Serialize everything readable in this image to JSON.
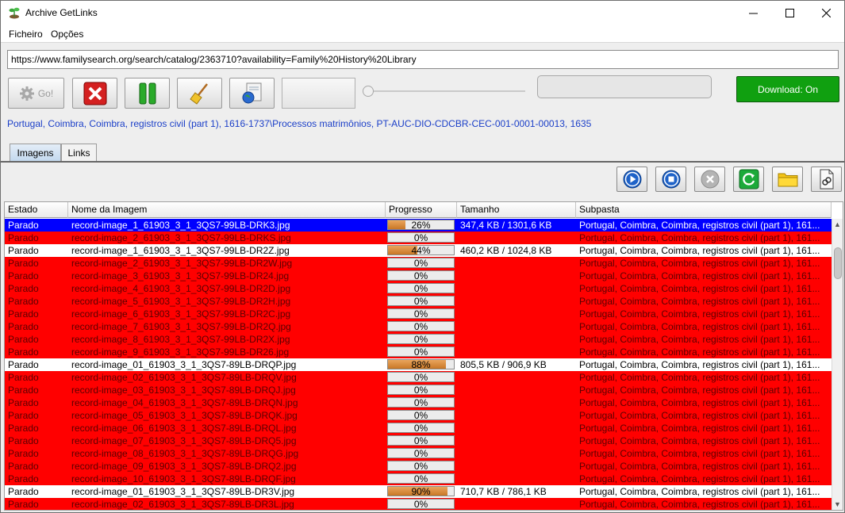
{
  "window": {
    "title": "Archive GetLinks"
  },
  "menu": {
    "items": [
      "Ficheiro",
      "Opções"
    ]
  },
  "url_field": {
    "value": "https://www.familysearch.org/search/catalog/2363710?availability=Family%20History%20Library"
  },
  "toolbar": {
    "go_label": "Go!",
    "download_label": "Download: On"
  },
  "path_label": "Portugal, Coimbra, Coimbra, registros civil (part 1), 1616-1737\\Processos matrimônios, PT-AUC-DIO-CDCBR-CEC-001-0001-00013, 1635",
  "tabs": [
    {
      "label": "Imagens",
      "active": true
    },
    {
      "label": "Links",
      "active": false
    }
  ],
  "table": {
    "columns": [
      "Estado",
      "Nome da Imagem",
      "Progresso",
      "Tamanho",
      "Subpasta"
    ],
    "rows": [
      {
        "style": "sel",
        "estado": "Parado",
        "nome": "record-image_1_61903_3_1_3QS7-99LB-DRK3.jpg",
        "progress": 26,
        "progress_label": "26%",
        "tamanho": "347,4  KB / 1301,6  KB",
        "subpasta": "Portugal, Coimbra, Coimbra, registros civil (part 1), 161..."
      },
      {
        "style": "red",
        "estado": "Parado",
        "nome": "record-image_2_61903_3_1_3QS7-99LB-DRKS.jpg",
        "progress": 0,
        "progress_label": "0%",
        "tamanho": "",
        "subpasta": "Portugal, Coimbra, Coimbra, registros civil (part 1), 161..."
      },
      {
        "style": "white",
        "estado": "Parado",
        "nome": "record-image_1_61903_3_1_3QS7-99LB-DR2Z.jpg",
        "progress": 44,
        "progress_label": "44%",
        "tamanho": "460,2  KB / 1024,8  KB",
        "subpasta": "Portugal, Coimbra, Coimbra, registros civil (part 1), 161..."
      },
      {
        "style": "red",
        "estado": "Parado",
        "nome": "record-image_2_61903_3_1_3QS7-99LB-DR2W.jpg",
        "progress": 0,
        "progress_label": "0%",
        "tamanho": "",
        "subpasta": "Portugal, Coimbra, Coimbra, registros civil (part 1), 161..."
      },
      {
        "style": "red",
        "estado": "Parado",
        "nome": "record-image_3_61903_3_1_3QS7-99LB-DR24.jpg",
        "progress": 0,
        "progress_label": "0%",
        "tamanho": "",
        "subpasta": "Portugal, Coimbra, Coimbra, registros civil (part 1), 161..."
      },
      {
        "style": "red",
        "estado": "Parado",
        "nome": "record-image_4_61903_3_1_3QS7-99LB-DR2D.jpg",
        "progress": 0,
        "progress_label": "0%",
        "tamanho": "",
        "subpasta": "Portugal, Coimbra, Coimbra, registros civil (part 1), 161..."
      },
      {
        "style": "red",
        "estado": "Parado",
        "nome": "record-image_5_61903_3_1_3QS7-99LB-DR2H.jpg",
        "progress": 0,
        "progress_label": "0%",
        "tamanho": "",
        "subpasta": "Portugal, Coimbra, Coimbra, registros civil (part 1), 161..."
      },
      {
        "style": "red",
        "estado": "Parado",
        "nome": "record-image_6_61903_3_1_3QS7-99LB-DR2C.jpg",
        "progress": 0,
        "progress_label": "0%",
        "tamanho": "",
        "subpasta": "Portugal, Coimbra, Coimbra, registros civil (part 1), 161..."
      },
      {
        "style": "red",
        "estado": "Parado",
        "nome": "record-image_7_61903_3_1_3QS7-99LB-DR2Q.jpg",
        "progress": 0,
        "progress_label": "0%",
        "tamanho": "",
        "subpasta": "Portugal, Coimbra, Coimbra, registros civil (part 1), 161..."
      },
      {
        "style": "red",
        "estado": "Parado",
        "nome": "record-image_8_61903_3_1_3QS7-99LB-DR2X.jpg",
        "progress": 0,
        "progress_label": "0%",
        "tamanho": "",
        "subpasta": "Portugal, Coimbra, Coimbra, registros civil (part 1), 161..."
      },
      {
        "style": "red",
        "estado": "Parado",
        "nome": "record-image_9_61903_3_1_3QS7-99LB-DR26.jpg",
        "progress": 0,
        "progress_label": "0%",
        "tamanho": "",
        "subpasta": "Portugal, Coimbra, Coimbra, registros civil (part 1), 161..."
      },
      {
        "style": "white",
        "estado": "Parado",
        "nome": "record-image_01_61903_3_1_3QS7-89LB-DRQP.jpg",
        "progress": 88,
        "progress_label": "88%",
        "tamanho": "805,5  KB / 906,9  KB",
        "subpasta": "Portugal, Coimbra, Coimbra, registros civil (part 1), 161..."
      },
      {
        "style": "red",
        "estado": "Parado",
        "nome": "record-image_02_61903_3_1_3QS7-89LB-DRQV.jpg",
        "progress": 0,
        "progress_label": "0%",
        "tamanho": "",
        "subpasta": "Portugal, Coimbra, Coimbra, registros civil (part 1), 161..."
      },
      {
        "style": "red",
        "estado": "Parado",
        "nome": "record-image_03_61903_3_1_3QS7-89LB-DRQJ.jpg",
        "progress": 0,
        "progress_label": "0%",
        "tamanho": "",
        "subpasta": "Portugal, Coimbra, Coimbra, registros civil (part 1), 161..."
      },
      {
        "style": "red",
        "estado": "Parado",
        "nome": "record-image_04_61903_3_1_3QS7-89LB-DRQN.jpg",
        "progress": 0,
        "progress_label": "0%",
        "tamanho": "",
        "subpasta": "Portugal, Coimbra, Coimbra, registros civil (part 1), 161..."
      },
      {
        "style": "red",
        "estado": "Parado",
        "nome": "record-image_05_61903_3_1_3QS7-89LB-DRQK.jpg",
        "progress": 0,
        "progress_label": "0%",
        "tamanho": "",
        "subpasta": "Portugal, Coimbra, Coimbra, registros civil (part 1), 161..."
      },
      {
        "style": "red",
        "estado": "Parado",
        "nome": "record-image_06_61903_3_1_3QS7-89LB-DRQL.jpg",
        "progress": 0,
        "progress_label": "0%",
        "tamanho": "",
        "subpasta": "Portugal, Coimbra, Coimbra, registros civil (part 1), 161..."
      },
      {
        "style": "red",
        "estado": "Parado",
        "nome": "record-image_07_61903_3_1_3QS7-89LB-DRQ5.jpg",
        "progress": 0,
        "progress_label": "0%",
        "tamanho": "",
        "subpasta": "Portugal, Coimbra, Coimbra, registros civil (part 1), 161..."
      },
      {
        "style": "red",
        "estado": "Parado",
        "nome": "record-image_08_61903_3_1_3QS7-89LB-DRQG.jpg",
        "progress": 0,
        "progress_label": "0%",
        "tamanho": "",
        "subpasta": "Portugal, Coimbra, Coimbra, registros civil (part 1), 161..."
      },
      {
        "style": "red",
        "estado": "Parado",
        "nome": "record-image_09_61903_3_1_3QS7-89LB-DRQ2.jpg",
        "progress": 0,
        "progress_label": "0%",
        "tamanho": "",
        "subpasta": "Portugal, Coimbra, Coimbra, registros civil (part 1), 161..."
      },
      {
        "style": "red",
        "estado": "Parado",
        "nome": "record-image_10_61903_3_1_3QS7-89LB-DRQF.jpg",
        "progress": 0,
        "progress_label": "0%",
        "tamanho": "",
        "subpasta": "Portugal, Coimbra, Coimbra, registros civil (part 1), 161..."
      },
      {
        "style": "white",
        "estado": "Parado",
        "nome": "record-image_01_61903_3_1_3QS7-89LB-DR3V.jpg",
        "progress": 90,
        "progress_label": "90%",
        "tamanho": "710,7  KB / 786,1  KB",
        "subpasta": "Portugal, Coimbra, Coimbra, registros civil (part 1), 161..."
      },
      {
        "style": "red",
        "estado": "Parado",
        "nome": "record-image_02_61903_3_1_3QS7-89LB-DR3L.jpg",
        "progress": 0,
        "progress_label": "0%",
        "tamanho": "",
        "subpasta": "Portugal, Coimbra, Coimbra, registros civil (part 1), 161..."
      }
    ]
  },
  "colors": {
    "row_red": "#ff0000",
    "row_selected": "#0000ff",
    "download_green": "#10a010",
    "path_blue": "#1b3fc8",
    "progress_orange": "#d8893a"
  },
  "icons": [
    "app-plant-icon",
    "gear-icon",
    "close-x-icon",
    "pause-icon",
    "broom-icon",
    "globe-page-icon",
    "play-icon",
    "stop-icon",
    "cancel-icon",
    "refresh-icon",
    "folder-icon",
    "document-link-icon"
  ]
}
